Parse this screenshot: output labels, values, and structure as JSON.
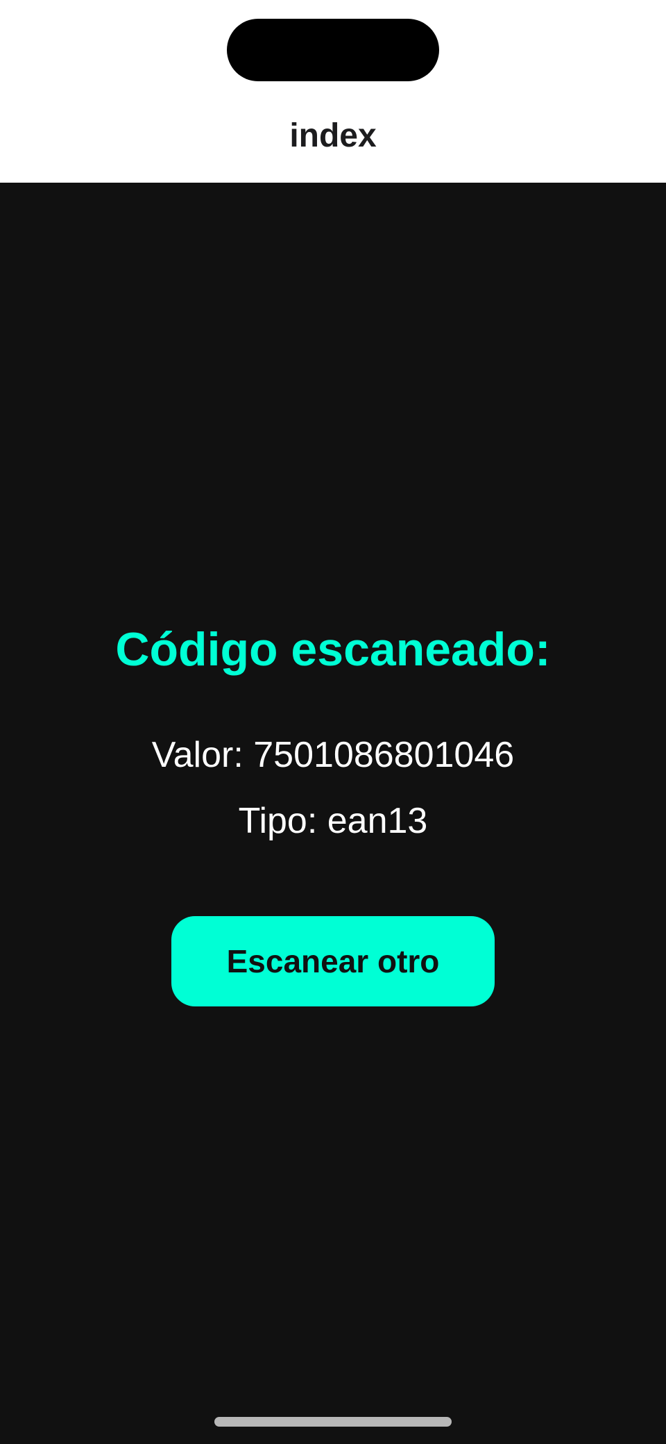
{
  "header": {
    "title": "index"
  },
  "result": {
    "title": "Código escaneado:",
    "value_text": "Valor: 7501086801046",
    "type_text": "Tipo: ean13"
  },
  "actions": {
    "scan_again_label": "Escanear otro"
  },
  "colors": {
    "accent": "#00ffd5",
    "background": "#111111",
    "header_background": "#ffffff"
  }
}
